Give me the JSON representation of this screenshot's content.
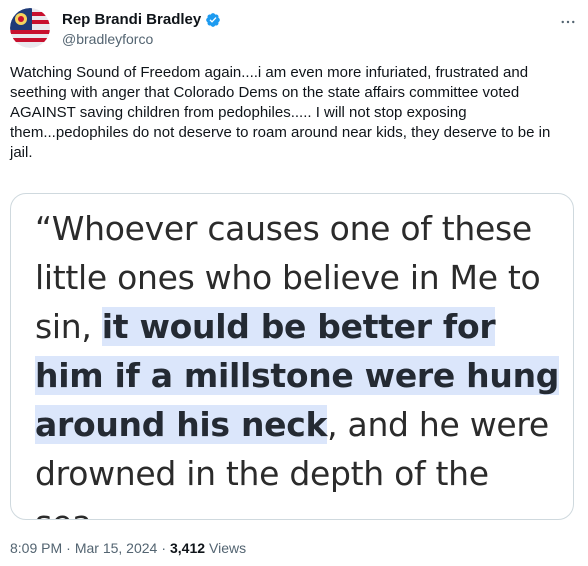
{
  "author": {
    "display_name": "Rep Brandi Bradley",
    "handle": "@bradleyforco",
    "verified": true
  },
  "tweet": {
    "text": "Watching Sound of Freedom again....i am even more infuriated, frustrated and seething with anger that Colorado Dems on the state affairs committee voted AGAINST saving children from pedophiles..... I will not stop exposing them...pedophiles do not deserve to roam around near kids, they deserve to be in jail."
  },
  "media": {
    "quote_before": "“Whoever causes one of these little ones who believe in Me to sin, ",
    "quote_highlight": "it would be better for him if a millstone were hung around his neck",
    "quote_after": ", and he were drowned in the depth of the sea."
  },
  "meta": {
    "time": "8:09 PM",
    "date": "Mar 15, 2024",
    "separator": "·",
    "views_count": "3,412",
    "views_label": "Views"
  },
  "colors": {
    "verified_blue": "#1d9bf0",
    "highlight": "#dbe6fb",
    "secondary_text": "#536471"
  },
  "icons": {
    "verified": "verified-badge-icon",
    "more": "more-options-icon"
  }
}
